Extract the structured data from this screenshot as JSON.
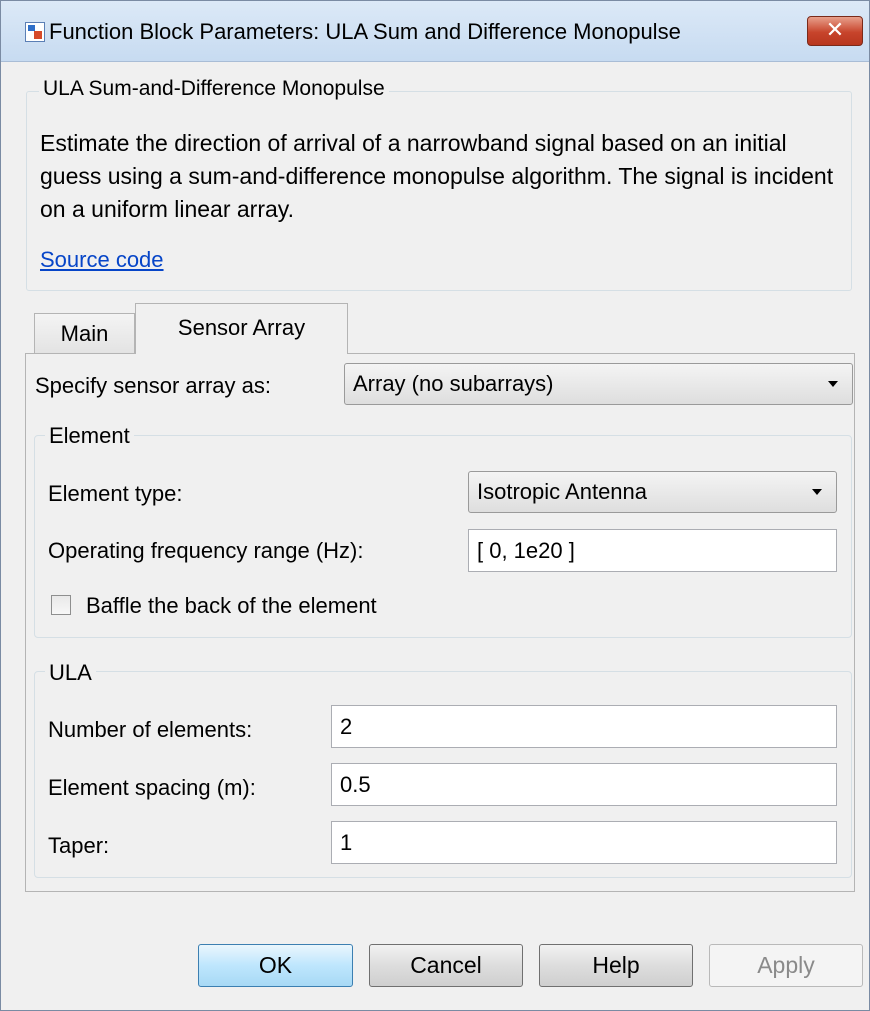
{
  "window": {
    "title": "Function Block Parameters: ULA Sum and Difference Monopulse",
    "close_label": "✕"
  },
  "description": {
    "group_title": "ULA Sum-and-Difference Monopulse",
    "text": "Estimate the direction of arrival of a narrowband signal based on an initial guess using a sum-and-difference monopulse algorithm. The signal is incident on a uniform linear array.",
    "source_link": "Source code"
  },
  "tabs": [
    {
      "label": "Main",
      "selected": false
    },
    {
      "label": "Sensor Array",
      "selected": true
    }
  ],
  "sensor_array": {
    "specify_label": "Specify sensor array as:",
    "specify_value": "Array (no subarrays)"
  },
  "element": {
    "group_title": "Element",
    "type_label": "Element type:",
    "type_value": "Isotropic Antenna",
    "freq_label": "Operating frequency range (Hz):",
    "freq_value": "[ 0, 1e20 ]",
    "baffle_label": "Baffle the back of the element",
    "baffle_checked": false
  },
  "ula": {
    "group_title": "ULA",
    "num_elements_label": "Number of elements:",
    "num_elements_value": "2",
    "spacing_label": "Element spacing (m):",
    "spacing_value": "0.5",
    "taper_label": "Taper:",
    "taper_value": "1"
  },
  "buttons": {
    "ok": "OK",
    "cancel": "Cancel",
    "help": "Help",
    "apply": "Apply"
  }
}
